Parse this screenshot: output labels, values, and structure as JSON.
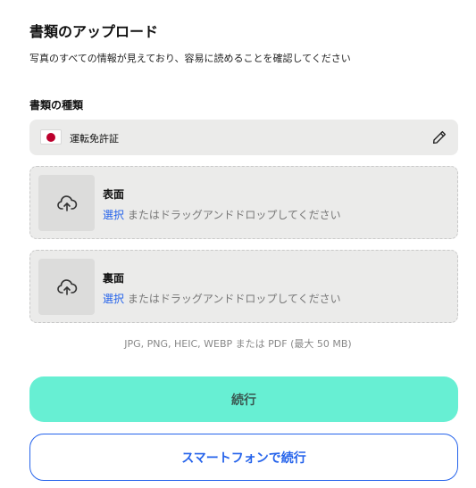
{
  "header": {
    "title": "書類のアップロード",
    "subtitle": "写真のすべての情報が見えており、容易に読めることを確認してください"
  },
  "document_type": {
    "label": "書類の種類",
    "selected": "運転免許証",
    "flag_icon": "japan-flag-icon",
    "edit_icon": "pencil-icon"
  },
  "uploads": {
    "front": {
      "title": "表面",
      "select_link": "選択",
      "hint": " またはドラッグアンドドロップしてください",
      "icon": "cloud-upload-icon"
    },
    "back": {
      "title": "裏面",
      "select_link": "選択",
      "hint": " またはドラッグアンドドロップしてください",
      "icon": "cloud-upload-icon"
    }
  },
  "formats_note": "JPG, PNG, HEIC, WEBP または PDF (最大 50 MB)",
  "actions": {
    "continue_label": "続行",
    "phone_label": "スマートフォンで続行"
  },
  "colors": {
    "accent_mint": "#67efd3",
    "link_blue": "#2563eb",
    "field_bg": "#ebebea",
    "flag_red": "#bc002d"
  }
}
